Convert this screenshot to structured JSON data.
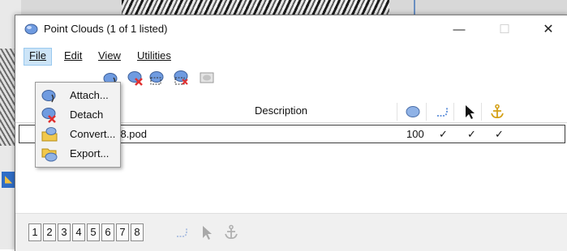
{
  "window": {
    "title": "Point Clouds (1 of 1 listed)",
    "min_glyph": "—",
    "max_glyph": "☐",
    "close_glyph": "✕"
  },
  "menu": {
    "file": "File",
    "edit": "Edit",
    "view": "View",
    "utilities": "Utilities"
  },
  "file_menu": [
    {
      "label": "Attach...",
      "icon": "attach-cloud-icon"
    },
    {
      "label": "Detach",
      "icon": "detach-cloud-icon"
    },
    {
      "label": "Convert...",
      "icon": "convert-folder-icon"
    },
    {
      "label": "Export...",
      "icon": "export-cloud-icon"
    }
  ],
  "list": {
    "header_description": "Description",
    "row": {
      "file": "018.pod",
      "density": "100",
      "col_a": "✓",
      "col_b": "✓",
      "col_c": "✓"
    }
  },
  "bottom": {
    "numbers": [
      "1",
      "2",
      "3",
      "4",
      "5",
      "6",
      "7",
      "8"
    ]
  },
  "colors": {
    "menu_highlight": "#cce4f7",
    "cloud_blue": "#5b8dd9",
    "red_x": "#e03030",
    "anchor_gold": "#d4a017"
  }
}
